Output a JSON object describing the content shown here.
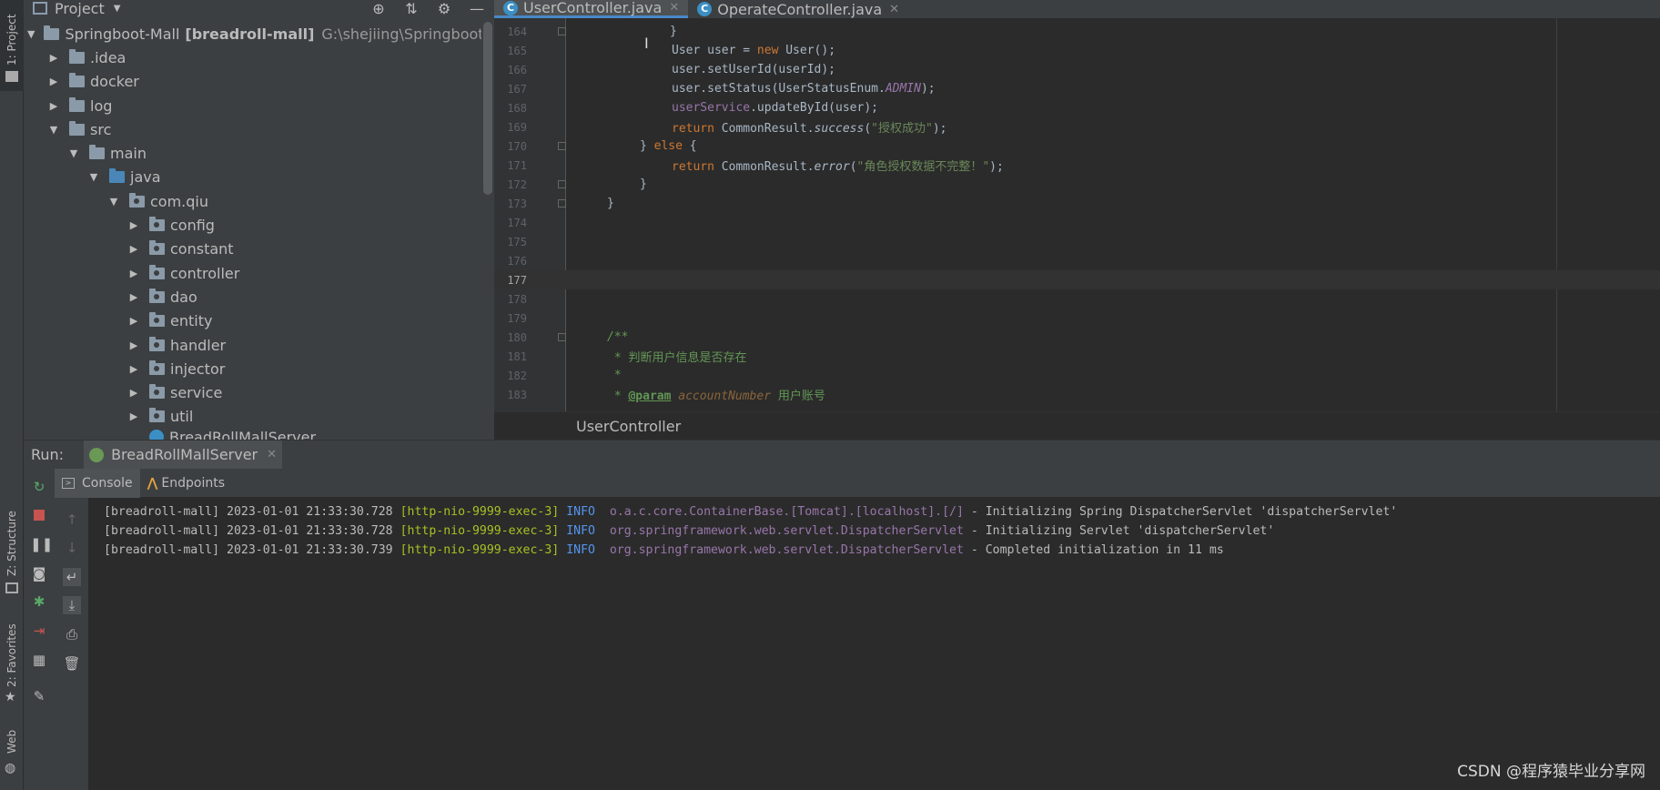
{
  "left_strip": {
    "project_tab": "1: Project",
    "structure_tab": "Z: Structure",
    "favorites_tab": "2: Favorites",
    "web_tab": "Web"
  },
  "project_panel": {
    "title": "Project",
    "tree": [
      {
        "name": "Springboot-Mall",
        "bold": "[breadroll-mall]",
        "path": "G:\\shejiing\\Springboot-Mall"
      },
      {
        "name": ".idea"
      },
      {
        "name": "docker"
      },
      {
        "name": "log"
      },
      {
        "name": "src"
      },
      {
        "name": "main"
      },
      {
        "name": "java"
      },
      {
        "name": "com.qiu"
      },
      {
        "name": "config"
      },
      {
        "name": "constant"
      },
      {
        "name": "controller"
      },
      {
        "name": "dao"
      },
      {
        "name": "entity"
      },
      {
        "name": "handler"
      },
      {
        "name": "injector"
      },
      {
        "name": "service"
      },
      {
        "name": "util"
      },
      {
        "name": "BreadRollMallServer"
      }
    ]
  },
  "editor": {
    "tabs": [
      {
        "label": "UserController.java",
        "icon": "C"
      },
      {
        "label": "OperateController.java",
        "icon": "C"
      }
    ],
    "line_numbers": [
      "164",
      "165",
      "166",
      "167",
      "168",
      "169",
      "170",
      "171",
      "172",
      "173",
      "174",
      "175",
      "176",
      "177",
      "178",
      "179",
      "180",
      "181",
      "182",
      "183"
    ],
    "code": {
      "l164": "}",
      "l165_a": "User user = ",
      "l165_b": "new",
      "l165_c": " User();",
      "l166": "user.setUserId(userId);",
      "l167_a": "user.setStatus(UserStatusEnum.",
      "l167_b": "ADMIN",
      "l167_c": ");",
      "l168_a": "userService",
      "l168_b": ".updateById(user);",
      "l169_a": "return",
      "l169_b": " CommonResult.",
      "l169_c": "success",
      "l169_d": "(",
      "l169_e": "\"授权成功\"",
      "l169_f": ");",
      "l170_a": "} ",
      "l170_b": "else",
      "l170_c": " {",
      "l171_a": "return",
      "l171_b": " CommonResult.",
      "l171_c": "error",
      "l171_d": "(",
      "l171_e": "\"角色授权数据不完整！\"",
      "l171_f": ");",
      "l172": "}",
      "l173": "}",
      "l180": "/**",
      "l181": " * 判断用户信息是否存在",
      "l182": " *",
      "l183_a": " * ",
      "l183_b": "@param",
      "l183_c": " accountNumber",
      "l183_d": " 用户账号"
    },
    "breadcrumb": "UserController"
  },
  "run_panel": {
    "label": "Run:",
    "config_tab": "BreadRollMallServer",
    "subtabs": [
      "Console",
      "Endpoints"
    ],
    "logs": [
      {
        "app": "[breadroll-mall]",
        "time": "2023-01-01 21:33:30.728",
        "thread": "[http-nio-9999-exec-3]",
        "level": "INFO",
        "logger": "o.a.c.core.ContainerBase.[Tomcat].[localhost].[/]",
        "msg": " - Initializing Spring DispatcherServlet 'dispatcherServlet'"
      },
      {
        "app": "[breadroll-mall]",
        "time": "2023-01-01 21:33:30.728",
        "thread": "[http-nio-9999-exec-3]",
        "level": "INFO",
        "logger": "org.springframework.web.servlet.DispatcherServlet",
        "msg": " - Initializing Servlet 'dispatcherServlet'"
      },
      {
        "app": "[breadroll-mall]",
        "time": "2023-01-01 21:33:30.739",
        "thread": "[http-nio-9999-exec-3]",
        "level": "INFO",
        "logger": "org.springframework.web.servlet.DispatcherServlet",
        "msg": " - Completed initialization in 11 ms"
      }
    ]
  },
  "watermark": "CSDN @程序猿毕业分享网"
}
